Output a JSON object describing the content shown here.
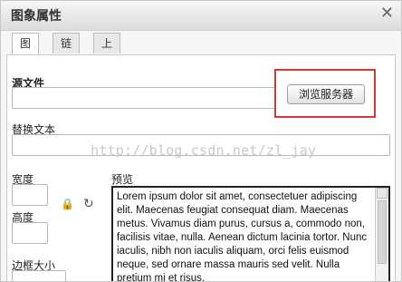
{
  "dialog": {
    "title": "图象属性",
    "close_icon": "close-icon"
  },
  "tabs": [
    {
      "label": "图象"
    },
    {
      "label": "链接"
    },
    {
      "label": "上传"
    }
  ],
  "form": {
    "source_label": "源文件",
    "browse_button": "浏览服务器",
    "alt_label": "替换文本",
    "width_label": "宽度",
    "height_label": "高度",
    "border_label": "边框大小",
    "lock_icon": "lock-icon",
    "reset_icon": "reset-icon"
  },
  "watermark": "http://blog.csdn.net/zl_jay",
  "preview": {
    "label": "预览",
    "text": "Lorem ipsum dolor sit amet, consectetuer adipiscing elit. Maecenas feugiat consequat diam. Maecenas metus. Vivamus diam purus, cursus a, commodo non, facilisis vitae, nulla. Aenean dictum lacinia tortor. Nunc iaculis, nibh non iaculis aliquam, orci felis euismod neque, sed ornare massa mauris sed velit. Nulla pretium mi et risus."
  },
  "colors": {
    "highlight": "#d23a3a"
  }
}
